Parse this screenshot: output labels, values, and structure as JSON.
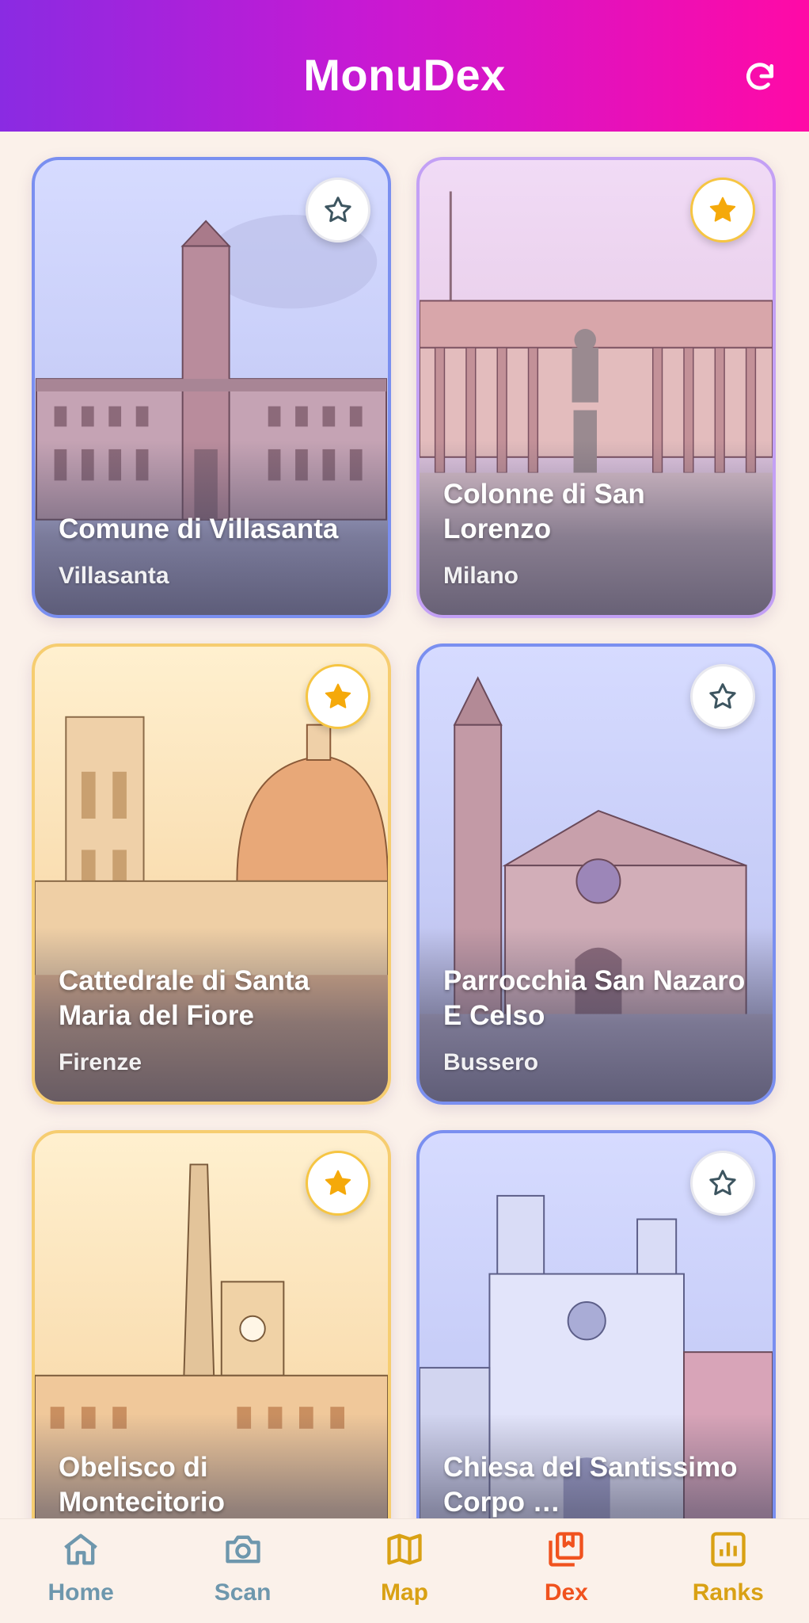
{
  "app": {
    "title": "MonuDex"
  },
  "colors": {
    "brand_start": "#8a2be2",
    "brand_end": "#ff0aa6",
    "background": "#fbf1ea",
    "active": "#f0521e",
    "gold": "#d9a114",
    "inactive": "#6e97ad"
  },
  "header": {
    "refresh_icon": "refresh-icon"
  },
  "monuments": [
    {
      "name": "Comune di Villasanta",
      "city": "Villasanta",
      "favorite": false
    },
    {
      "name": "Colonne di San Lorenzo",
      "city": "Milano",
      "favorite": true
    },
    {
      "name": "Cattedrale di Santa Maria del Fiore",
      "city": "Firenze",
      "favorite": true
    },
    {
      "name": "Parrocchia San Nazaro E Celso",
      "city": "Bussero",
      "favorite": false
    },
    {
      "name": "Obelisco di Montecitorio",
      "city": "",
      "favorite": true
    },
    {
      "name": "Chiesa del Santissimo Corpo …",
      "city": "",
      "favorite": false
    }
  ],
  "nav": {
    "items": [
      {
        "label": "Home",
        "icon": "home-icon"
      },
      {
        "label": "Scan",
        "icon": "camera-icon"
      },
      {
        "label": "Map",
        "icon": "map-icon"
      },
      {
        "label": "Dex",
        "icon": "bookmark-collection-icon",
        "active": true
      },
      {
        "label": "Ranks",
        "icon": "bar-chart-icon"
      }
    ]
  }
}
